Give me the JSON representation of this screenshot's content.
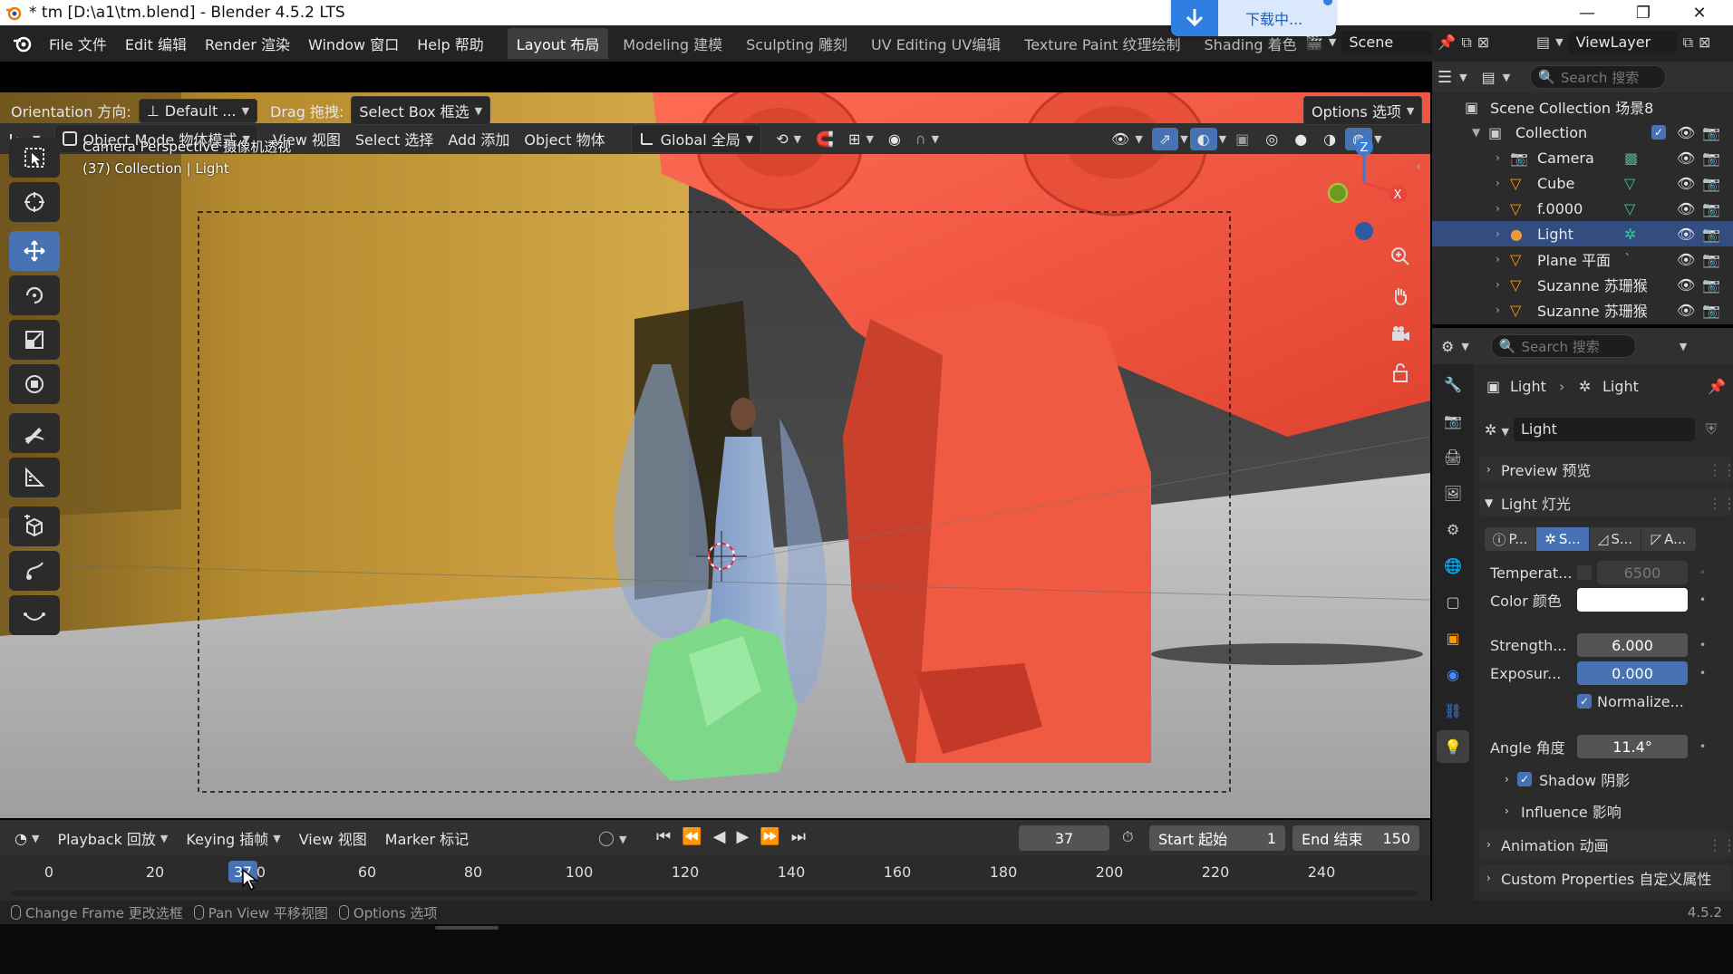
{
  "window": {
    "title": "* tm [D:\\a1\\tm.blend] - Blender 4.5.2 LTS",
    "download_label": "下载中...",
    "minimize": "—",
    "maximize": "❐",
    "close": "✕"
  },
  "menu": {
    "file": "File 文件",
    "edit": "Edit 编辑",
    "render": "Render 渲染",
    "window": "Window 窗口",
    "help": "Help 帮助"
  },
  "workspaces": [
    {
      "label": "Layout 布局",
      "active": true
    },
    {
      "label": "Modeling 建模",
      "active": false
    },
    {
      "label": "Sculpting 雕刻",
      "active": false
    },
    {
      "label": "UV Editing UV编辑",
      "active": false
    },
    {
      "label": "Texture Paint 纹理绘制",
      "active": false
    },
    {
      "label": "Shading 着色",
      "active": false
    }
  ],
  "scene_name": "Scene",
  "view_layer": "ViewLayer",
  "viewport_header": {
    "mode": "Object Mode 物体模式",
    "view": "View 视图",
    "select": "Select 选择",
    "add": "Add 添加",
    "object": "Object 物体",
    "transform_orientation": "Global 全局"
  },
  "tool_settings": {
    "orientation_label": "Orientation 方向:",
    "orientation_value": "Default ...",
    "drag_label": "Drag 拖拽:",
    "drag_value": "Select Box 框选",
    "options": "Options 选项"
  },
  "viewport": {
    "camera_label": "Camera Perspective 摄像机透视",
    "collection_label": "(37) Collection | Light",
    "axis_x": "X",
    "axis_z": "Z"
  },
  "outliner": {
    "search_placeholder": "Search 搜索",
    "scene_collection": "Scene Collection 场景8",
    "collection": "Collection",
    "items": [
      {
        "name": "Camera",
        "selected": false
      },
      {
        "name": "Cube",
        "selected": false
      },
      {
        "name": "f.0000",
        "selected": false
      },
      {
        "name": "Light",
        "selected": true
      },
      {
        "name": "Plane 平面",
        "selected": false
      },
      {
        "name": "Suzanne 苏珊猴",
        "selected": false
      },
      {
        "name": "Suzanne 苏珊猴",
        "selected": false
      }
    ]
  },
  "properties": {
    "search_placeholder": "Search 搜索",
    "breadcrumb_object": "Light",
    "breadcrumb_data": "Light",
    "datablock_name": "Light",
    "preview_panel": "Preview 预览",
    "light_panel": "Light 灯光",
    "light_types": [
      "P...",
      "S...",
      "S...",
      "A..."
    ],
    "active_light_type": "S...",
    "temperature_label": "Temperat...",
    "temperature_value": "6500",
    "color_label": "Color 颜色",
    "color_value": "#ffffff",
    "strength_label": "Strength...",
    "strength_value": "6.000",
    "exposure_label": "Exposur...",
    "exposure_value": "0.000",
    "normalize_label": "Normalize...",
    "angle_label": "Angle 角度",
    "angle_value": "11.4°",
    "shadow_label": "Shadow 阴影",
    "influence_label": "Influence 影响",
    "animation_panel": "Animation 动画",
    "custom_props_panel": "Custom Properties 自定义属性"
  },
  "timeline": {
    "playback": "Playback 回放",
    "keying": "Keying 插帧",
    "view": "View 视图",
    "marker": "Marker 标记",
    "current_frame": "37",
    "start_label": "Start 起始",
    "start_value": "1",
    "end_label": "End 结束",
    "end_value": "150",
    "ruler_labels": [
      "0",
      "20",
      "0",
      "60",
      "80",
      "100",
      "120",
      "140",
      "160",
      "180",
      "200",
      "220",
      "240"
    ],
    "frame_marker": "37"
  },
  "statusbar": {
    "change_frame": "Change Frame 更改选框",
    "pan_view": "Pan View 平移视图",
    "options": "Options 选项",
    "version": "4.5.2"
  },
  "colors": {
    "accent": "#4772b3",
    "selection": "#334d80",
    "header_bg": "#303030",
    "panel_bg": "#2b2b2b"
  }
}
